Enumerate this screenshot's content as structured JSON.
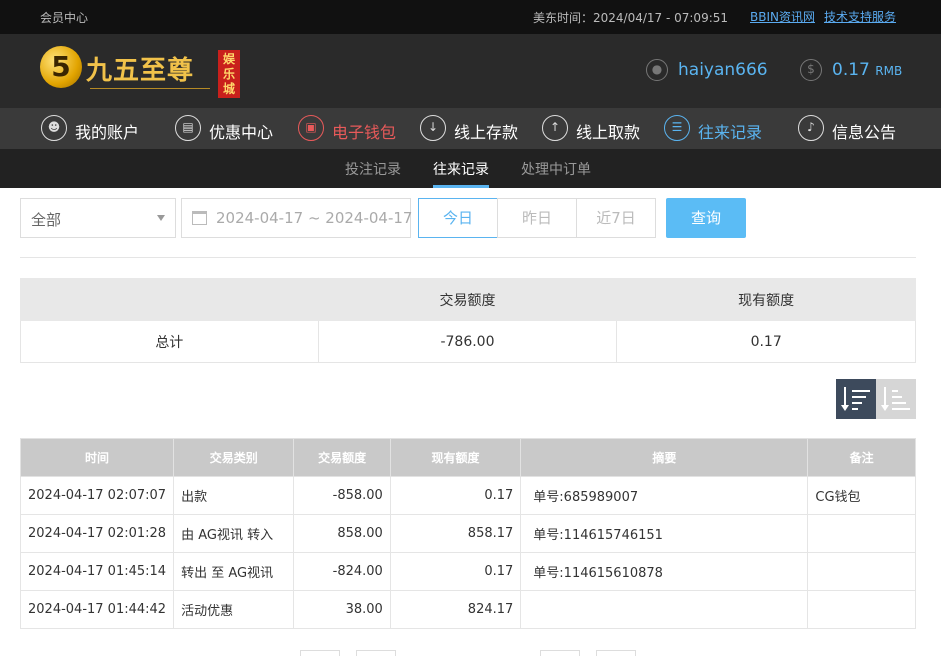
{
  "topbar": {
    "member_center": "会员中心",
    "time": "美东时间：2024/04/17 - 07:09:51",
    "link1": "BBIN资讯网",
    "link2": "技术支持服务"
  },
  "logo": {
    "numeral": "5",
    "name": "九五至尊",
    "tag": "娱乐城"
  },
  "user": {
    "name": "haiyan666",
    "balance": "0.17",
    "unit": "RMB"
  },
  "nav": [
    {
      "label": "我的账户",
      "icon": "user-icon"
    },
    {
      "label": "优惠中心",
      "icon": "gift-icon"
    },
    {
      "label": "电子钱包",
      "icon": "wallet-icon"
    },
    {
      "label": "线上存款",
      "icon": "deposit-icon"
    },
    {
      "label": "线上取款",
      "icon": "withdraw-icon"
    },
    {
      "label": "往来记录",
      "icon": "records-icon"
    },
    {
      "label": "信息公告",
      "icon": "bell-icon"
    }
  ],
  "subnav": [
    "投注记录",
    "往来记录",
    "处理中订单"
  ],
  "filters": {
    "type_value": "全部",
    "date_range": "2024-04-17 ~ 2024-04-17",
    "today": "今日",
    "yesterday": "昨日",
    "last7": "近7日",
    "query": "查询"
  },
  "summary": {
    "headers": [
      "",
      "交易额度",
      "现有额度"
    ],
    "row": [
      "总计",
      "-786.00",
      "0.17"
    ]
  },
  "records": {
    "headers": [
      "时间",
      "交易类别",
      "交易额度",
      "现有额度",
      "摘要",
      "备注"
    ],
    "rows": [
      [
        "2024-04-17 02:07:07",
        "出款",
        "-858.00",
        "0.17",
        "单号:685989007",
        "CG钱包"
      ],
      [
        "2024-04-17 02:01:28",
        "由 AG视讯 转入",
        "858.00",
        "858.17",
        "单号:114615746151",
        ""
      ],
      [
        "2024-04-17 01:45:14",
        "转出 至 AG视讯",
        "-824.00",
        "0.17",
        "单号:114615610878",
        ""
      ],
      [
        "2024-04-17 01:44:42",
        "活动优惠",
        "38.00",
        "824.17",
        "",
        ""
      ]
    ]
  }
}
